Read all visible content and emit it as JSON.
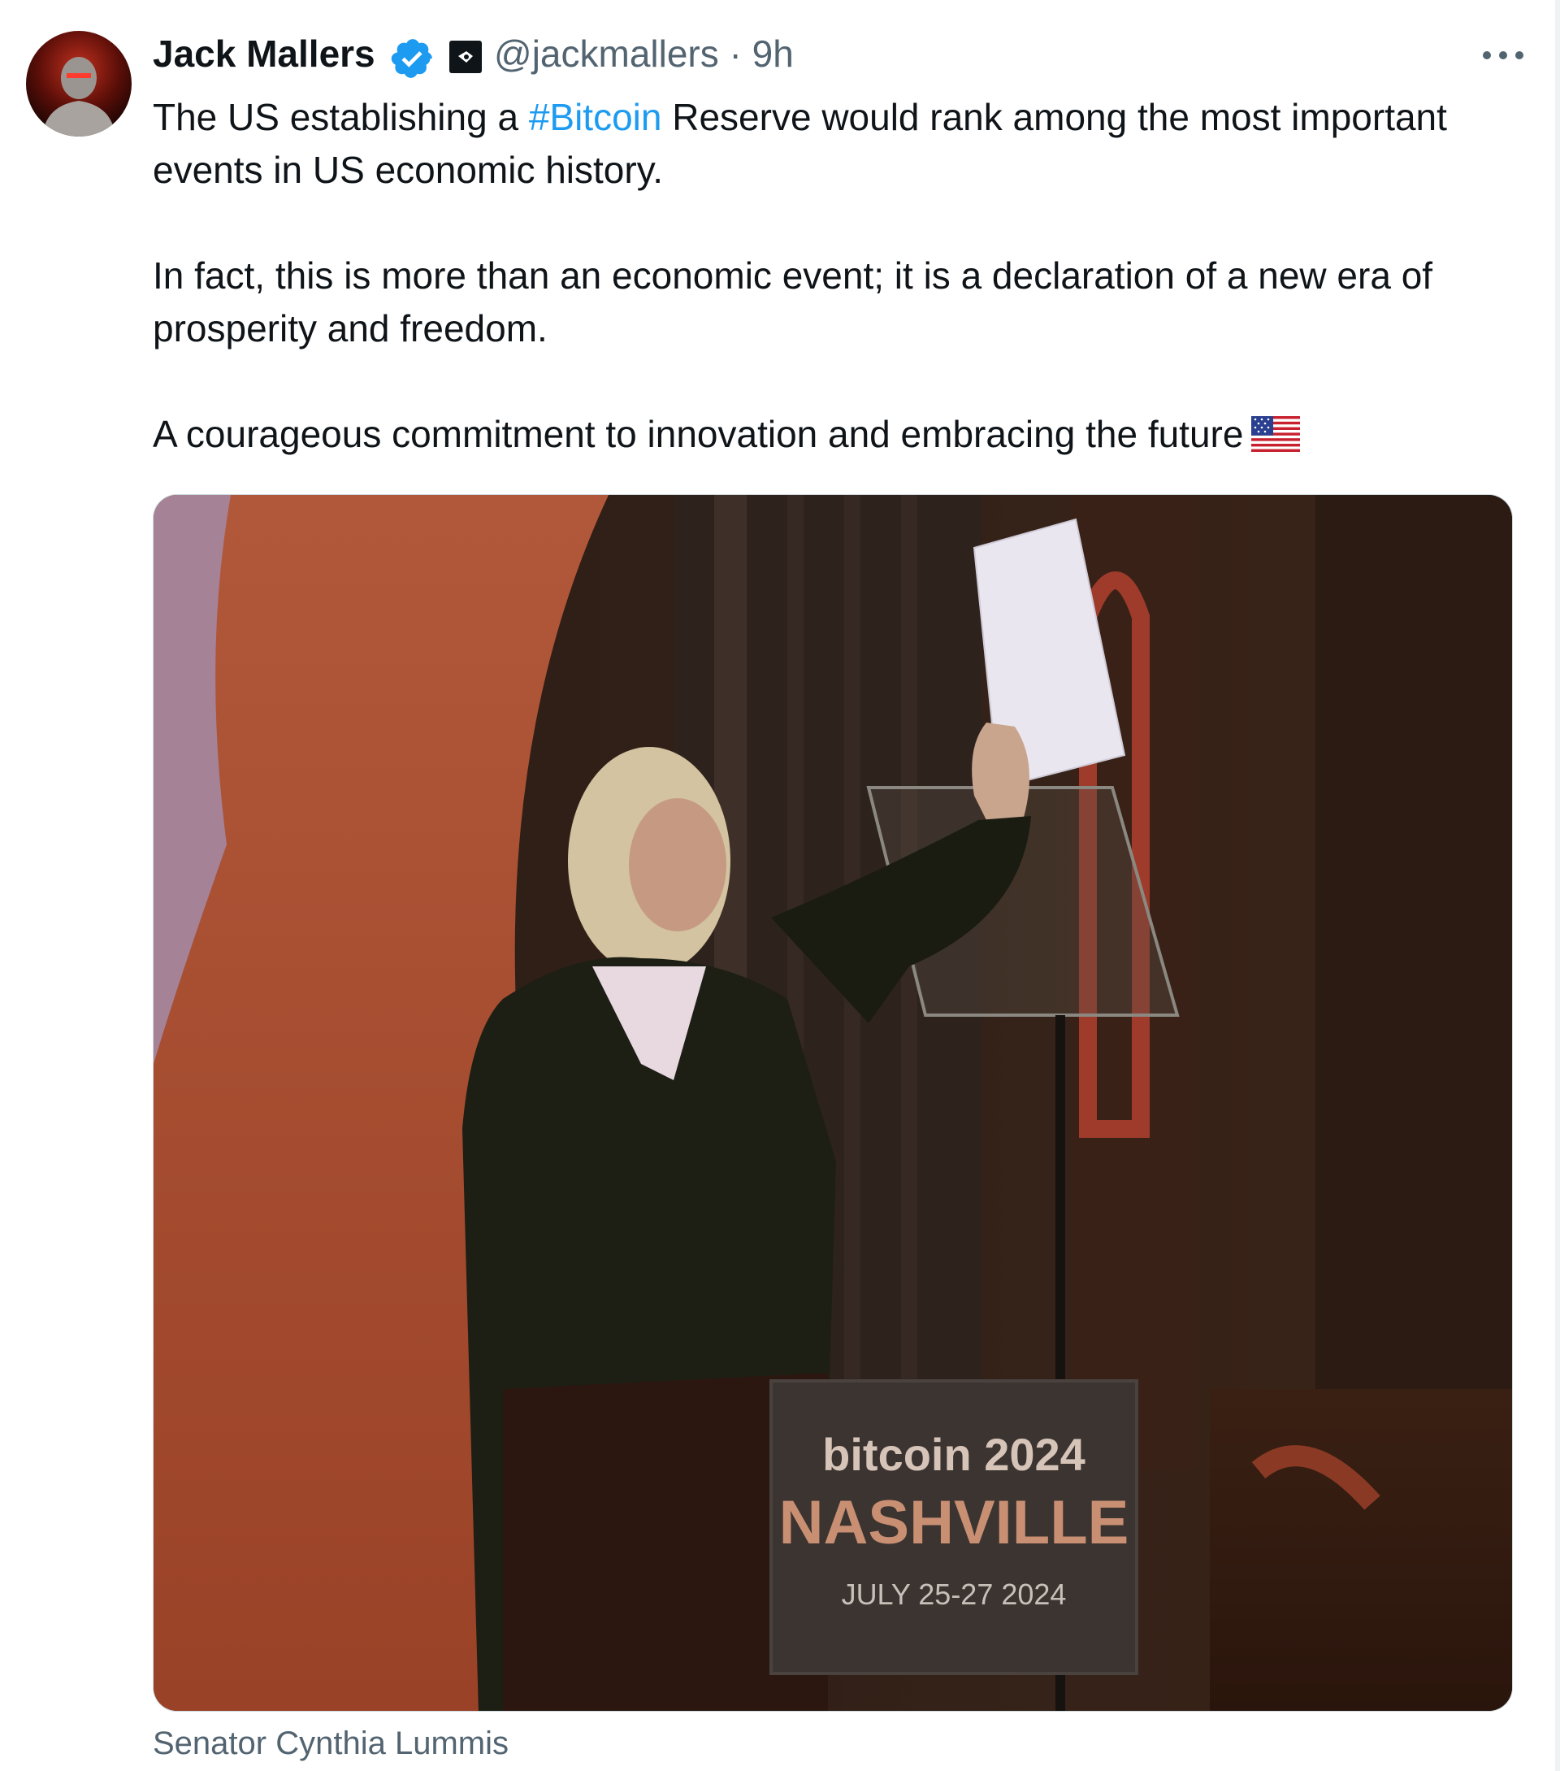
{
  "author": {
    "name": "Jack Mallers",
    "handle": "@jackmallers",
    "time": "· 9h",
    "verified": true,
    "avatar_icon": "profile-avatar"
  },
  "menu_icon": "more-options-icon",
  "body": {
    "line1_before": "The US establishing a ",
    "hashtag": "#Bitcoin",
    "line1_after": " Reserve would rank among the most important events in US economic history.",
    "paragraph2": "In fact, this is more than an economic event; it is a declaration of a new era of prosperity and freedom.",
    "paragraph3": "A courageous commitment to innovation and embracing the future",
    "flag_icon": "us-flag-emoji"
  },
  "media": {
    "podium_brand": "bitcoin 2024",
    "podium_city": "NASHVILLE",
    "podium_dates": "JULY 25-27 2024",
    "caption": "Senator Cynthia Lummis"
  },
  "colors": {
    "accent": "#1d9bf0",
    "secondary_text": "#536471",
    "primary_text": "#0f1419"
  }
}
